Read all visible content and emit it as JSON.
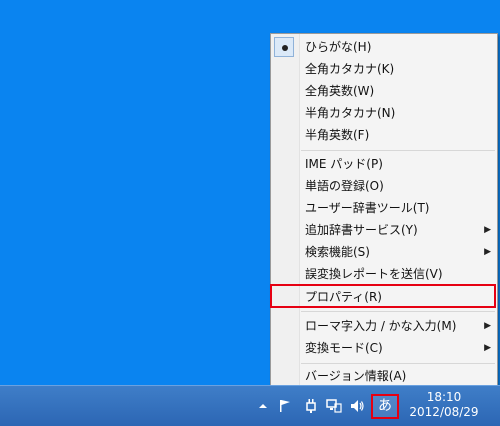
{
  "menu": {
    "items": [
      {
        "label": "ひらがな(H)",
        "checked": true
      },
      {
        "label": "全角カタカナ(K)"
      },
      {
        "label": "全角英数(W)"
      },
      {
        "label": "半角カタカナ(N)"
      },
      {
        "label": "半角英数(F)"
      },
      {
        "label": "IME パッド(P)"
      },
      {
        "label": "単語の登録(O)"
      },
      {
        "label": "ユーザー辞書ツール(T)"
      },
      {
        "label": "追加辞書サービス(Y)",
        "submenu": true
      },
      {
        "label": "検索機能(S)",
        "submenu": true
      },
      {
        "label": "誤変換レポートを送信(V)"
      },
      {
        "label": "プロパティ(R)",
        "highlighted": true
      },
      {
        "label": "ローマ字入力 / かな入力(M)",
        "submenu": true
      },
      {
        "label": "変換モード(C)",
        "submenu": true
      },
      {
        "label": "バージョン情報(A)"
      }
    ],
    "submenu_glyph": "▶"
  },
  "taskbar": {
    "ime_mode": "あ",
    "time": "18:10",
    "date": "2012/08/29"
  },
  "colors": {
    "desktop": "#0a84f0",
    "taskbar": "#2c66b4",
    "highlight": "#e60012"
  }
}
